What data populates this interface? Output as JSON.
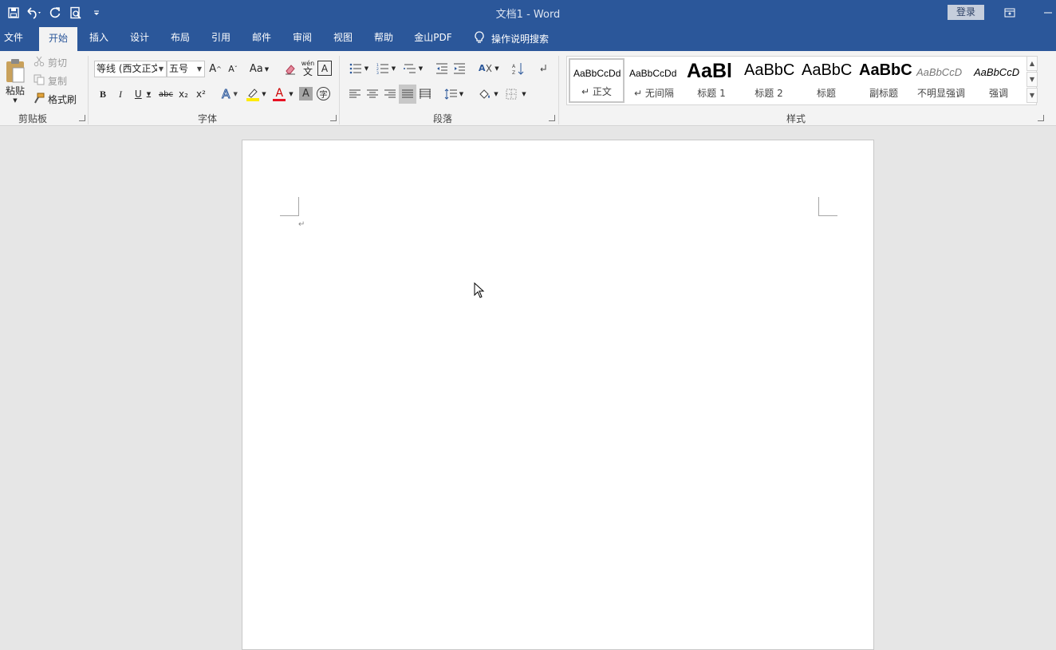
{
  "window": {
    "title": "文档1  -  Word",
    "login_label": "登录"
  },
  "qat": {
    "icons": [
      "save-icon",
      "undo-icon",
      "redo-icon",
      "print-preview-icon",
      "customize-qat-icon"
    ]
  },
  "tabs": [
    {
      "label": "文件"
    },
    {
      "label": "开始"
    },
    {
      "label": "插入"
    },
    {
      "label": "设计"
    },
    {
      "label": "布局"
    },
    {
      "label": "引用"
    },
    {
      "label": "邮件"
    },
    {
      "label": "审阅"
    },
    {
      "label": "视图"
    },
    {
      "label": "帮助"
    },
    {
      "label": "金山PDF"
    }
  ],
  "active_tab": "开始",
  "tell_me": "操作说明搜索",
  "clipboard": {
    "paste": "粘贴",
    "cut": "剪切",
    "copy": "复制",
    "format_painter": "格式刷",
    "group": "剪贴板"
  },
  "font": {
    "font_name": "等线 (西文正文)",
    "font_size": "五号",
    "change_case": "Aa",
    "group": "字体",
    "bold": "B",
    "italic": "I",
    "underline": "U",
    "strike": "abc",
    "subscript": "x₂",
    "superscript": "x²",
    "phonetic": "wén",
    "char_border": "A",
    "char_shading": "A",
    "enclose": "字",
    "grow": "A",
    "shrink": "A"
  },
  "paragraph": {
    "group": "段落"
  },
  "styles": {
    "group": "样式",
    "items": [
      {
        "sample": "AaBbCcDd",
        "name": "正文"
      },
      {
        "sample": "AaBbCcDd",
        "name": "无间隔"
      },
      {
        "sample": "AaBl",
        "name": "标题 1"
      },
      {
        "sample": "AaBbC",
        "name": "标题 2"
      },
      {
        "sample": "AaBbC",
        "name": "标题"
      },
      {
        "sample": "AaBbC",
        "name": "副标题"
      },
      {
        "sample": "AaBbCcD",
        "name": "不明显强调"
      },
      {
        "sample": "AaBbCcD",
        "name": "强调"
      }
    ]
  },
  "colors": {
    "title_bar": "#2b579a",
    "font_color": "#e81123",
    "highlight": "#ffeb00"
  },
  "document": {
    "pilcrow": "↵"
  }
}
